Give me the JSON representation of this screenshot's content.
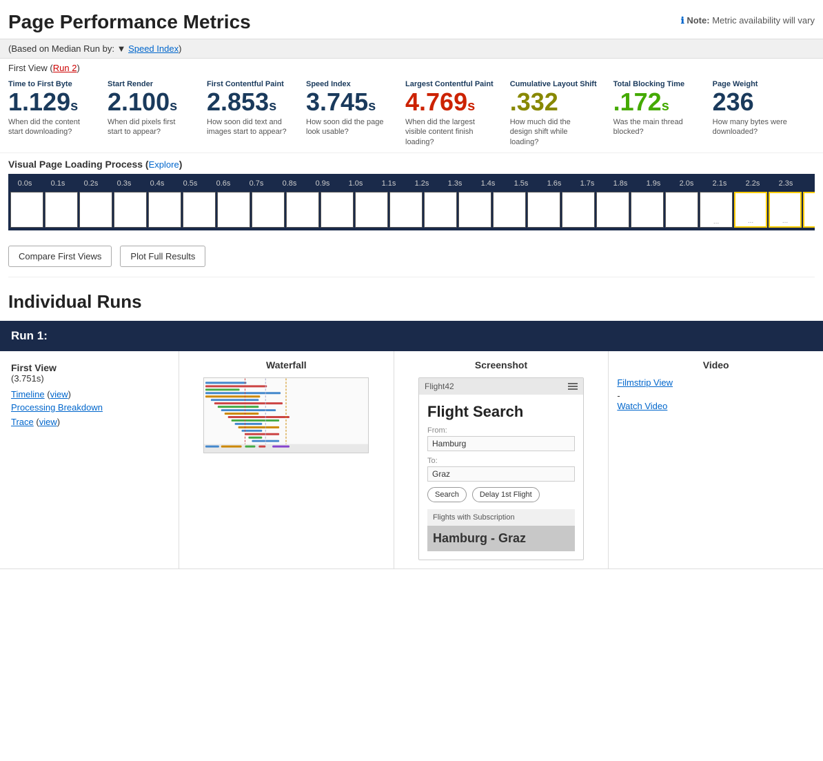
{
  "page": {
    "title": "Page Performance Metrics",
    "note_label": "Note:",
    "note_text": " Metric availability will vary",
    "median_bar": "Based on Median Run by:",
    "median_sort": "Speed Index",
    "first_view_label": "First View (",
    "first_view_link": "Run 2",
    "first_view_suffix": ")"
  },
  "metrics": [
    {
      "id": "ttfb",
      "label": "Time to First Byte",
      "value": "1.129",
      "unit": "s",
      "color": "normal",
      "desc": "When did the content start downloading?"
    },
    {
      "id": "start_render",
      "label": "Start Render",
      "value": "2.100",
      "unit": "s",
      "color": "normal",
      "desc": "When did pixels first start to appear?"
    },
    {
      "id": "fcp",
      "label": "First Contentful Paint",
      "value": "2.853",
      "unit": "s",
      "color": "normal",
      "desc": "How soon did text and images start to appear?"
    },
    {
      "id": "speed_index",
      "label": "Speed Index",
      "value": "3.745",
      "unit": "s",
      "color": "normal",
      "desc": "How soon did the page look usable?"
    },
    {
      "id": "lcp",
      "label": "Largest Contentful Paint",
      "value": "4.769",
      "unit": "s",
      "color": "red",
      "desc": "When did the largest visible content finish loading?"
    },
    {
      "id": "cls",
      "label": "Cumulative Layout Shift",
      "value": ".332",
      "unit": "",
      "color": "olive",
      "desc": "How much did the design shift while loading?"
    },
    {
      "id": "tbt",
      "label": "Total Blocking Time",
      "value": ".172",
      "unit": "s",
      "color": "green",
      "desc": "Was the main thread blocked?"
    },
    {
      "id": "page_weight",
      "label": "Page Weight",
      "value": "236",
      "unit": "",
      "color": "normal",
      "desc": "How many bytes were downloaded?"
    }
  ],
  "visual_process": {
    "title": "Visual Page Loading Process",
    "explore_link": "Explore",
    "times": [
      "0.0s",
      "0.1s",
      "0.2s",
      "0.3s",
      "0.4s",
      "0.5s",
      "0.6s",
      "0.7s",
      "0.8s",
      "0.9s",
      "1.0s",
      "1.1s",
      "1.2s",
      "1.3s",
      "1.4s",
      "1.5s",
      "1.6s",
      "1.7s",
      "1.8s",
      "1.9s",
      "2.0s",
      "2.1s",
      "2.2s",
      "2.3s"
    ]
  },
  "actions": {
    "compare_first_views": "Compare First Views",
    "plot_full_results": "Plot Full Results"
  },
  "individual_runs": {
    "title": "Individual Runs",
    "run1": {
      "label": "Run 1:",
      "columns": {
        "waterfall": "Waterfall",
        "screenshot": "Screenshot",
        "video": "Video"
      },
      "first_view": {
        "label": "First View",
        "time": "(3.751s)",
        "timeline_label": "Timeline",
        "timeline_view": "view",
        "processing_breakdown": "Processing Breakdown",
        "trace_label": "Trace",
        "trace_view": "view"
      },
      "video": {
        "filmstrip_view": "Filmstrip View",
        "dash": "-",
        "watch_video": "Watch Video"
      },
      "screenshot_mockup": {
        "topbar_label": "Flight42",
        "title": "Flight Search",
        "from_label": "From:",
        "from_value": "Hamburg",
        "to_label": "To:",
        "to_value": "Graz",
        "search_btn": "Search",
        "delay_btn": "Delay 1st Flight",
        "section_label": "Flights with Subscription",
        "route": "Hamburg - Graz"
      }
    }
  }
}
